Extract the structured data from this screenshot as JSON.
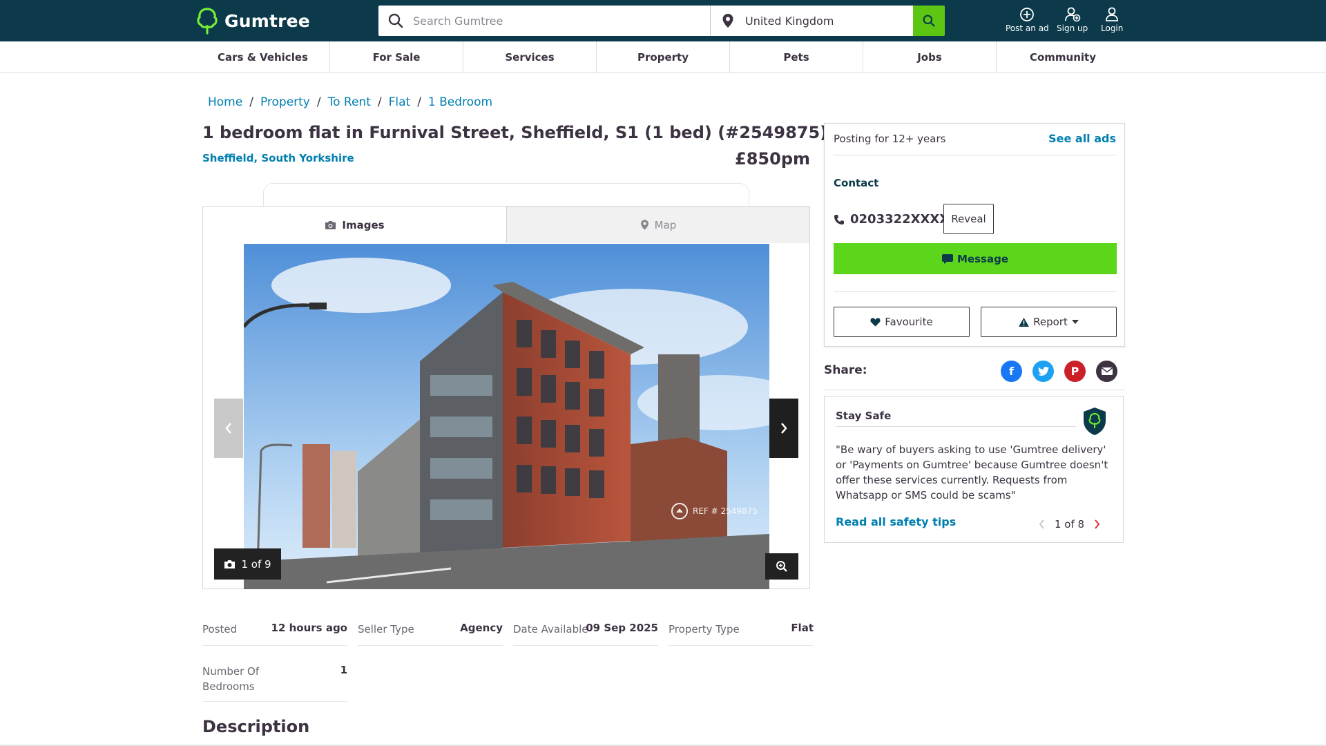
{
  "header": {
    "logo_text": "Gumtree",
    "search_placeholder": "Search Gumtree",
    "location_value": "United Kingdom",
    "actions": [
      {
        "label": "Post an ad",
        "icon": "plus-circle-icon"
      },
      {
        "label": "Sign up",
        "icon": "user-add-icon"
      },
      {
        "label": "Login",
        "icon": "user-icon"
      }
    ]
  },
  "categories": [
    "Cars & Vehicles",
    "For Sale",
    "Services",
    "Property",
    "Pets",
    "Jobs",
    "Community"
  ],
  "breadcrumb": [
    "Home",
    "Property",
    "To Rent",
    "Flat",
    "1 Bedroom"
  ],
  "listing": {
    "title": "1 bedroom flat in Furnival Street, Sheffield, S1 (1 bed) (#2549875)",
    "location": "Sheffield, South Yorkshire",
    "price": "£850pm"
  },
  "gallery": {
    "tab_images": "Images",
    "tab_map": "Map",
    "counter": "1 of 9",
    "ref_text": "REF # 2549875"
  },
  "attributes": [
    {
      "key": "Posted",
      "value": "12 hours ago"
    },
    {
      "key": "Seller Type",
      "value": "Agency"
    },
    {
      "key": "Date Available",
      "value": "09 Sep 2025"
    },
    {
      "key": "Property Type",
      "value": "Flat"
    },
    {
      "key": "Number Of Bedrooms",
      "value": "1"
    }
  ],
  "description_title": "Description",
  "seller": {
    "posting_for": "Posting for 12+ years",
    "see_all": "See all ads",
    "contact_heading": "Contact",
    "phone": "0203322XXXX",
    "reveal_label": "Reveal",
    "message_label": "Message",
    "favourite_label": "Favourite",
    "report_label": "Report"
  },
  "share": {
    "label": "Share:",
    "icons": [
      "facebook-icon",
      "twitter-icon",
      "pinterest-icon",
      "email-icon"
    ]
  },
  "stay_safe": {
    "heading": "Stay Safe",
    "quote": "\"Be wary of buyers asking to use 'Gumtree delivery' or 'Payments on Gumtree' because Gumtree doesn't offer these services currently. Requests from Whatsapp or SMS could be scams\"",
    "link": "Read all safety tips",
    "pager": "1 of 8"
  },
  "colors": {
    "header_bg": "#0c3a4a",
    "accent_green": "#5cc613",
    "link_blue": "#007fb0",
    "text_dark": "#3c3241"
  }
}
